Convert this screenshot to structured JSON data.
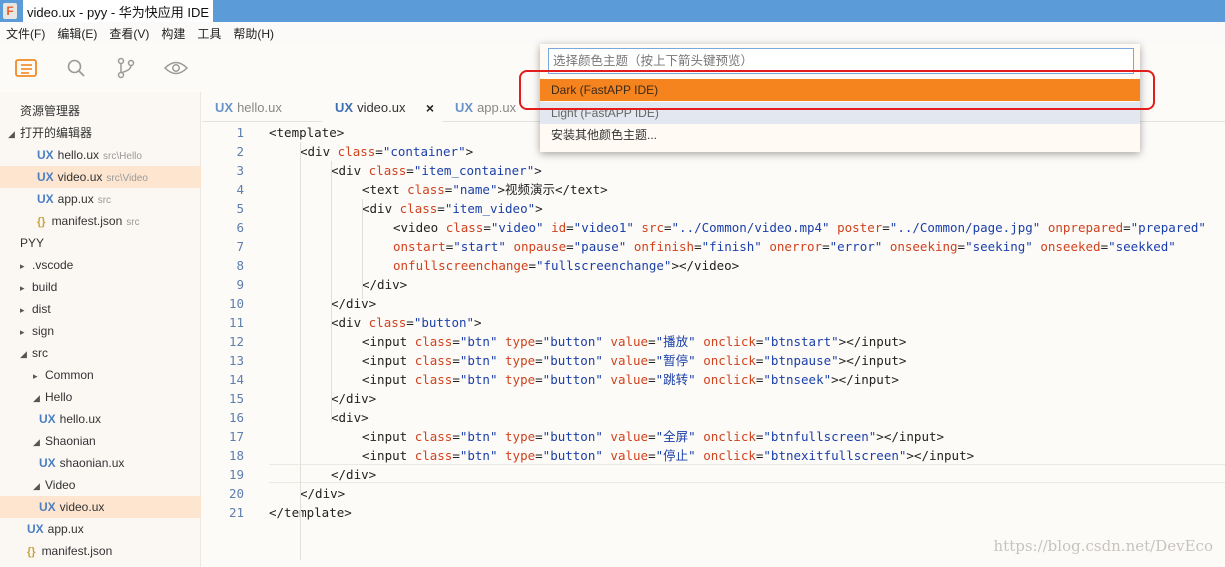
{
  "window": {
    "title": "video.ux - pyy - 华为快应用 IDE",
    "app_icon": "F"
  },
  "menu": [
    "文件(F)",
    "编辑(E)",
    "查看(V)",
    "构建",
    "工具",
    "帮助(H)"
  ],
  "activity_bar": [
    "explorer-icon",
    "search-icon",
    "source-control-icon",
    "preview-eye-icon"
  ],
  "sidebar": {
    "title": "资源管理器",
    "open_editors_label": "打开的编辑器",
    "open_editors": [
      {
        "badge": "UX",
        "name": "hello.ux",
        "path": "src\\Hello"
      },
      {
        "badge": "UX",
        "name": "video.ux",
        "path": "src\\Video"
      },
      {
        "badge": "UX",
        "name": "app.ux",
        "path": "src"
      },
      {
        "badge": "{}",
        "name": "manifest.json",
        "path": "src"
      }
    ],
    "project_label": "PYY",
    "tree": [
      {
        "arrow": "▸",
        "name": ".vscode"
      },
      {
        "arrow": "▸",
        "name": "build"
      },
      {
        "arrow": "▸",
        "name": "dist"
      },
      {
        "arrow": "▸",
        "name": "sign"
      },
      {
        "arrow": "◢",
        "name": "src"
      },
      {
        "arrow": "▸",
        "name": "Common"
      },
      {
        "arrow": "◢",
        "name": "Hello"
      },
      {
        "badge": "UX",
        "name": "hello.ux"
      },
      {
        "arrow": "◢",
        "name": "Shaonian"
      },
      {
        "badge": "UX",
        "name": "shaonian.ux"
      },
      {
        "arrow": "◢",
        "name": "Video"
      },
      {
        "badge": "UX",
        "name": "video.ux"
      },
      {
        "badge": "UX",
        "name": "app.ux"
      },
      {
        "badge": "{}",
        "name": "manifest.json"
      }
    ]
  },
  "tabs": [
    {
      "badge": "UX",
      "label": "hello.ux"
    },
    {
      "badge": "UX",
      "label": "video.ux",
      "close": "×"
    },
    {
      "badge": "UX",
      "label": "app.ux"
    }
  ],
  "code": [
    {
      "n": "1",
      "tokens": [
        [
          "tag",
          "<template>"
        ]
      ]
    },
    {
      "n": "2",
      "tokens": [
        [
          "tag",
          "<div "
        ],
        [
          "attr",
          "class"
        ],
        [
          "tag",
          "="
        ],
        [
          "val",
          "\"container\""
        ],
        [
          "tag",
          ">"
        ]
      ]
    },
    {
      "n": "3",
      "tokens": [
        [
          "tag",
          "<div "
        ],
        [
          "attr",
          "class"
        ],
        [
          "tag",
          "="
        ],
        [
          "val",
          "\"item_container\""
        ],
        [
          "tag",
          ">"
        ]
      ]
    },
    {
      "n": "4",
      "tokens": [
        [
          "tag",
          "<text "
        ],
        [
          "attr",
          "class"
        ],
        [
          "tag",
          "="
        ],
        [
          "val",
          "\"name\""
        ],
        [
          "tag",
          ">视频演示</text>"
        ]
      ]
    },
    {
      "n": "5",
      "tokens": [
        [
          "tag",
          "<div "
        ],
        [
          "attr",
          "class"
        ],
        [
          "tag",
          "="
        ],
        [
          "val",
          "\"item_video\""
        ],
        [
          "tag",
          ">"
        ]
      ]
    },
    {
      "n": "6",
      "tokens": [
        [
          "tag",
          "<video "
        ],
        [
          "attr",
          "class"
        ],
        [
          "tag",
          "="
        ],
        [
          "val",
          "\"video\""
        ],
        [
          "tag",
          " "
        ],
        [
          "attr",
          "id"
        ],
        [
          "tag",
          "="
        ],
        [
          "val",
          "\"video1\""
        ],
        [
          "tag",
          " "
        ],
        [
          "attr",
          "src"
        ],
        [
          "tag",
          "="
        ],
        [
          "val",
          "\"../Common/video.mp4\""
        ],
        [
          "tag",
          " "
        ],
        [
          "attr",
          "poster"
        ],
        [
          "tag",
          "="
        ],
        [
          "val",
          "\"../Common/page.jpg\""
        ],
        [
          "tag",
          " "
        ],
        [
          "attr",
          "onprepared"
        ],
        [
          "tag",
          "="
        ],
        [
          "val",
          "\"prepared\""
        ]
      ]
    },
    {
      "n": "7",
      "tokens": [
        [
          "attr",
          "onstart"
        ],
        [
          "tag",
          "="
        ],
        [
          "val",
          "\"start\""
        ],
        [
          "tag",
          " "
        ],
        [
          "attr",
          "onpause"
        ],
        [
          "tag",
          "="
        ],
        [
          "val",
          "\"pause\""
        ],
        [
          "tag",
          " "
        ],
        [
          "attr",
          "onfinish"
        ],
        [
          "tag",
          "="
        ],
        [
          "val",
          "\"finish\""
        ],
        [
          "tag",
          " "
        ],
        [
          "attr",
          "onerror"
        ],
        [
          "tag",
          "="
        ],
        [
          "val",
          "\"error\""
        ],
        [
          "tag",
          " "
        ],
        [
          "attr",
          "onseeking"
        ],
        [
          "tag",
          "="
        ],
        [
          "val",
          "\"seeking\""
        ],
        [
          "tag",
          " "
        ],
        [
          "attr",
          "onseeked"
        ],
        [
          "tag",
          "="
        ],
        [
          "val",
          "\"seekked\""
        ]
      ]
    },
    {
      "n": "8",
      "tokens": [
        [
          "attr",
          "onfullscreenchange"
        ],
        [
          "tag",
          "="
        ],
        [
          "val",
          "\"fullscreenchange\""
        ],
        [
          "tag",
          "></video>"
        ]
      ]
    },
    {
      "n": "9",
      "tokens": [
        [
          "tag",
          "</div>"
        ]
      ]
    },
    {
      "n": "10",
      "tokens": [
        [
          "tag",
          "</div>"
        ]
      ]
    },
    {
      "n": "11",
      "tokens": [
        [
          "tag",
          "<div "
        ],
        [
          "attr",
          "class"
        ],
        [
          "tag",
          "="
        ],
        [
          "val",
          "\"button\""
        ],
        [
          "tag",
          ">"
        ]
      ]
    },
    {
      "n": "12",
      "tokens": [
        [
          "tag",
          "<input "
        ],
        [
          "attr",
          "class"
        ],
        [
          "tag",
          "="
        ],
        [
          "val",
          "\"btn\""
        ],
        [
          "tag",
          " "
        ],
        [
          "attr",
          "type"
        ],
        [
          "tag",
          "="
        ],
        [
          "val",
          "\"button\""
        ],
        [
          "tag",
          " "
        ],
        [
          "attr",
          "value"
        ],
        [
          "tag",
          "="
        ],
        [
          "val",
          "\"播放\""
        ],
        [
          "tag",
          " "
        ],
        [
          "attr",
          "onclick"
        ],
        [
          "tag",
          "="
        ],
        [
          "val",
          "\"btnstart\""
        ],
        [
          "tag",
          "></input>"
        ]
      ]
    },
    {
      "n": "13",
      "tokens": [
        [
          "tag",
          "<input "
        ],
        [
          "attr",
          "class"
        ],
        [
          "tag",
          "="
        ],
        [
          "val",
          "\"btn\""
        ],
        [
          "tag",
          " "
        ],
        [
          "attr",
          "type"
        ],
        [
          "tag",
          "="
        ],
        [
          "val",
          "\"button\""
        ],
        [
          "tag",
          " "
        ],
        [
          "attr",
          "value"
        ],
        [
          "tag",
          "="
        ],
        [
          "val",
          "\"暂停\""
        ],
        [
          "tag",
          " "
        ],
        [
          "attr",
          "onclick"
        ],
        [
          "tag",
          "="
        ],
        [
          "val",
          "\"btnpause\""
        ],
        [
          "tag",
          "></input>"
        ]
      ]
    },
    {
      "n": "14",
      "tokens": [
        [
          "tag",
          "<input "
        ],
        [
          "attr",
          "class"
        ],
        [
          "tag",
          "="
        ],
        [
          "val",
          "\"btn\""
        ],
        [
          "tag",
          " "
        ],
        [
          "attr",
          "type"
        ],
        [
          "tag",
          "="
        ],
        [
          "val",
          "\"button\""
        ],
        [
          "tag",
          " "
        ],
        [
          "attr",
          "value"
        ],
        [
          "tag",
          "="
        ],
        [
          "val",
          "\"跳转\""
        ],
        [
          "tag",
          " "
        ],
        [
          "attr",
          "onclick"
        ],
        [
          "tag",
          "="
        ],
        [
          "val",
          "\"btnseek\""
        ],
        [
          "tag",
          "></input>"
        ]
      ]
    },
    {
      "n": "15",
      "tokens": [
        [
          "tag",
          "</div>"
        ]
      ]
    },
    {
      "n": "16",
      "tokens": [
        [
          "tag",
          "<div>"
        ]
      ]
    },
    {
      "n": "17",
      "tokens": [
        [
          "tag",
          "<input "
        ],
        [
          "attr",
          "class"
        ],
        [
          "tag",
          "="
        ],
        [
          "val",
          "\"btn\""
        ],
        [
          "tag",
          " "
        ],
        [
          "attr",
          "type"
        ],
        [
          "tag",
          "="
        ],
        [
          "val",
          "\"button\""
        ],
        [
          "tag",
          " "
        ],
        [
          "attr",
          "value"
        ],
        [
          "tag",
          "="
        ],
        [
          "val",
          "\"全屏\""
        ],
        [
          "tag",
          " "
        ],
        [
          "attr",
          "onclick"
        ],
        [
          "tag",
          "="
        ],
        [
          "val",
          "\"btnfullscreen\""
        ],
        [
          "tag",
          "></input>"
        ]
      ]
    },
    {
      "n": "18",
      "tokens": [
        [
          "tag",
          "<input "
        ],
        [
          "attr",
          "class"
        ],
        [
          "tag",
          "="
        ],
        [
          "val",
          "\"btn\""
        ],
        [
          "tag",
          " "
        ],
        [
          "attr",
          "type"
        ],
        [
          "tag",
          "="
        ],
        [
          "val",
          "\"button\""
        ],
        [
          "tag",
          " "
        ],
        [
          "attr",
          "value"
        ],
        [
          "tag",
          "="
        ],
        [
          "val",
          "\"停止\""
        ],
        [
          "tag",
          " "
        ],
        [
          "attr",
          "onclick"
        ],
        [
          "tag",
          "="
        ],
        [
          "val",
          "\"btnexitfullscreen\""
        ],
        [
          "tag",
          "></input>"
        ]
      ]
    },
    {
      "n": "19",
      "tokens": [
        [
          "tag",
          "</div>"
        ]
      ]
    },
    {
      "n": "20",
      "tokens": [
        [
          "tag",
          "</div>"
        ]
      ]
    },
    {
      "n": "21",
      "tokens": [
        [
          "tag",
          "</template>"
        ]
      ]
    }
  ],
  "palette": {
    "placeholder": "选择颜色主题（按上下箭头键预览）",
    "options": [
      "Dark (FastAPP IDE)",
      "Light (FastAPP IDE)",
      "安装其他颜色主题..."
    ]
  },
  "watermark": "https://blog.csdn.net/DevEco",
  "colors": {
    "accent": "#f5841f",
    "titlebar": "#5a9bd8",
    "highlight": "#e31c1c",
    "ux_badge": "#4a7fc3"
  }
}
